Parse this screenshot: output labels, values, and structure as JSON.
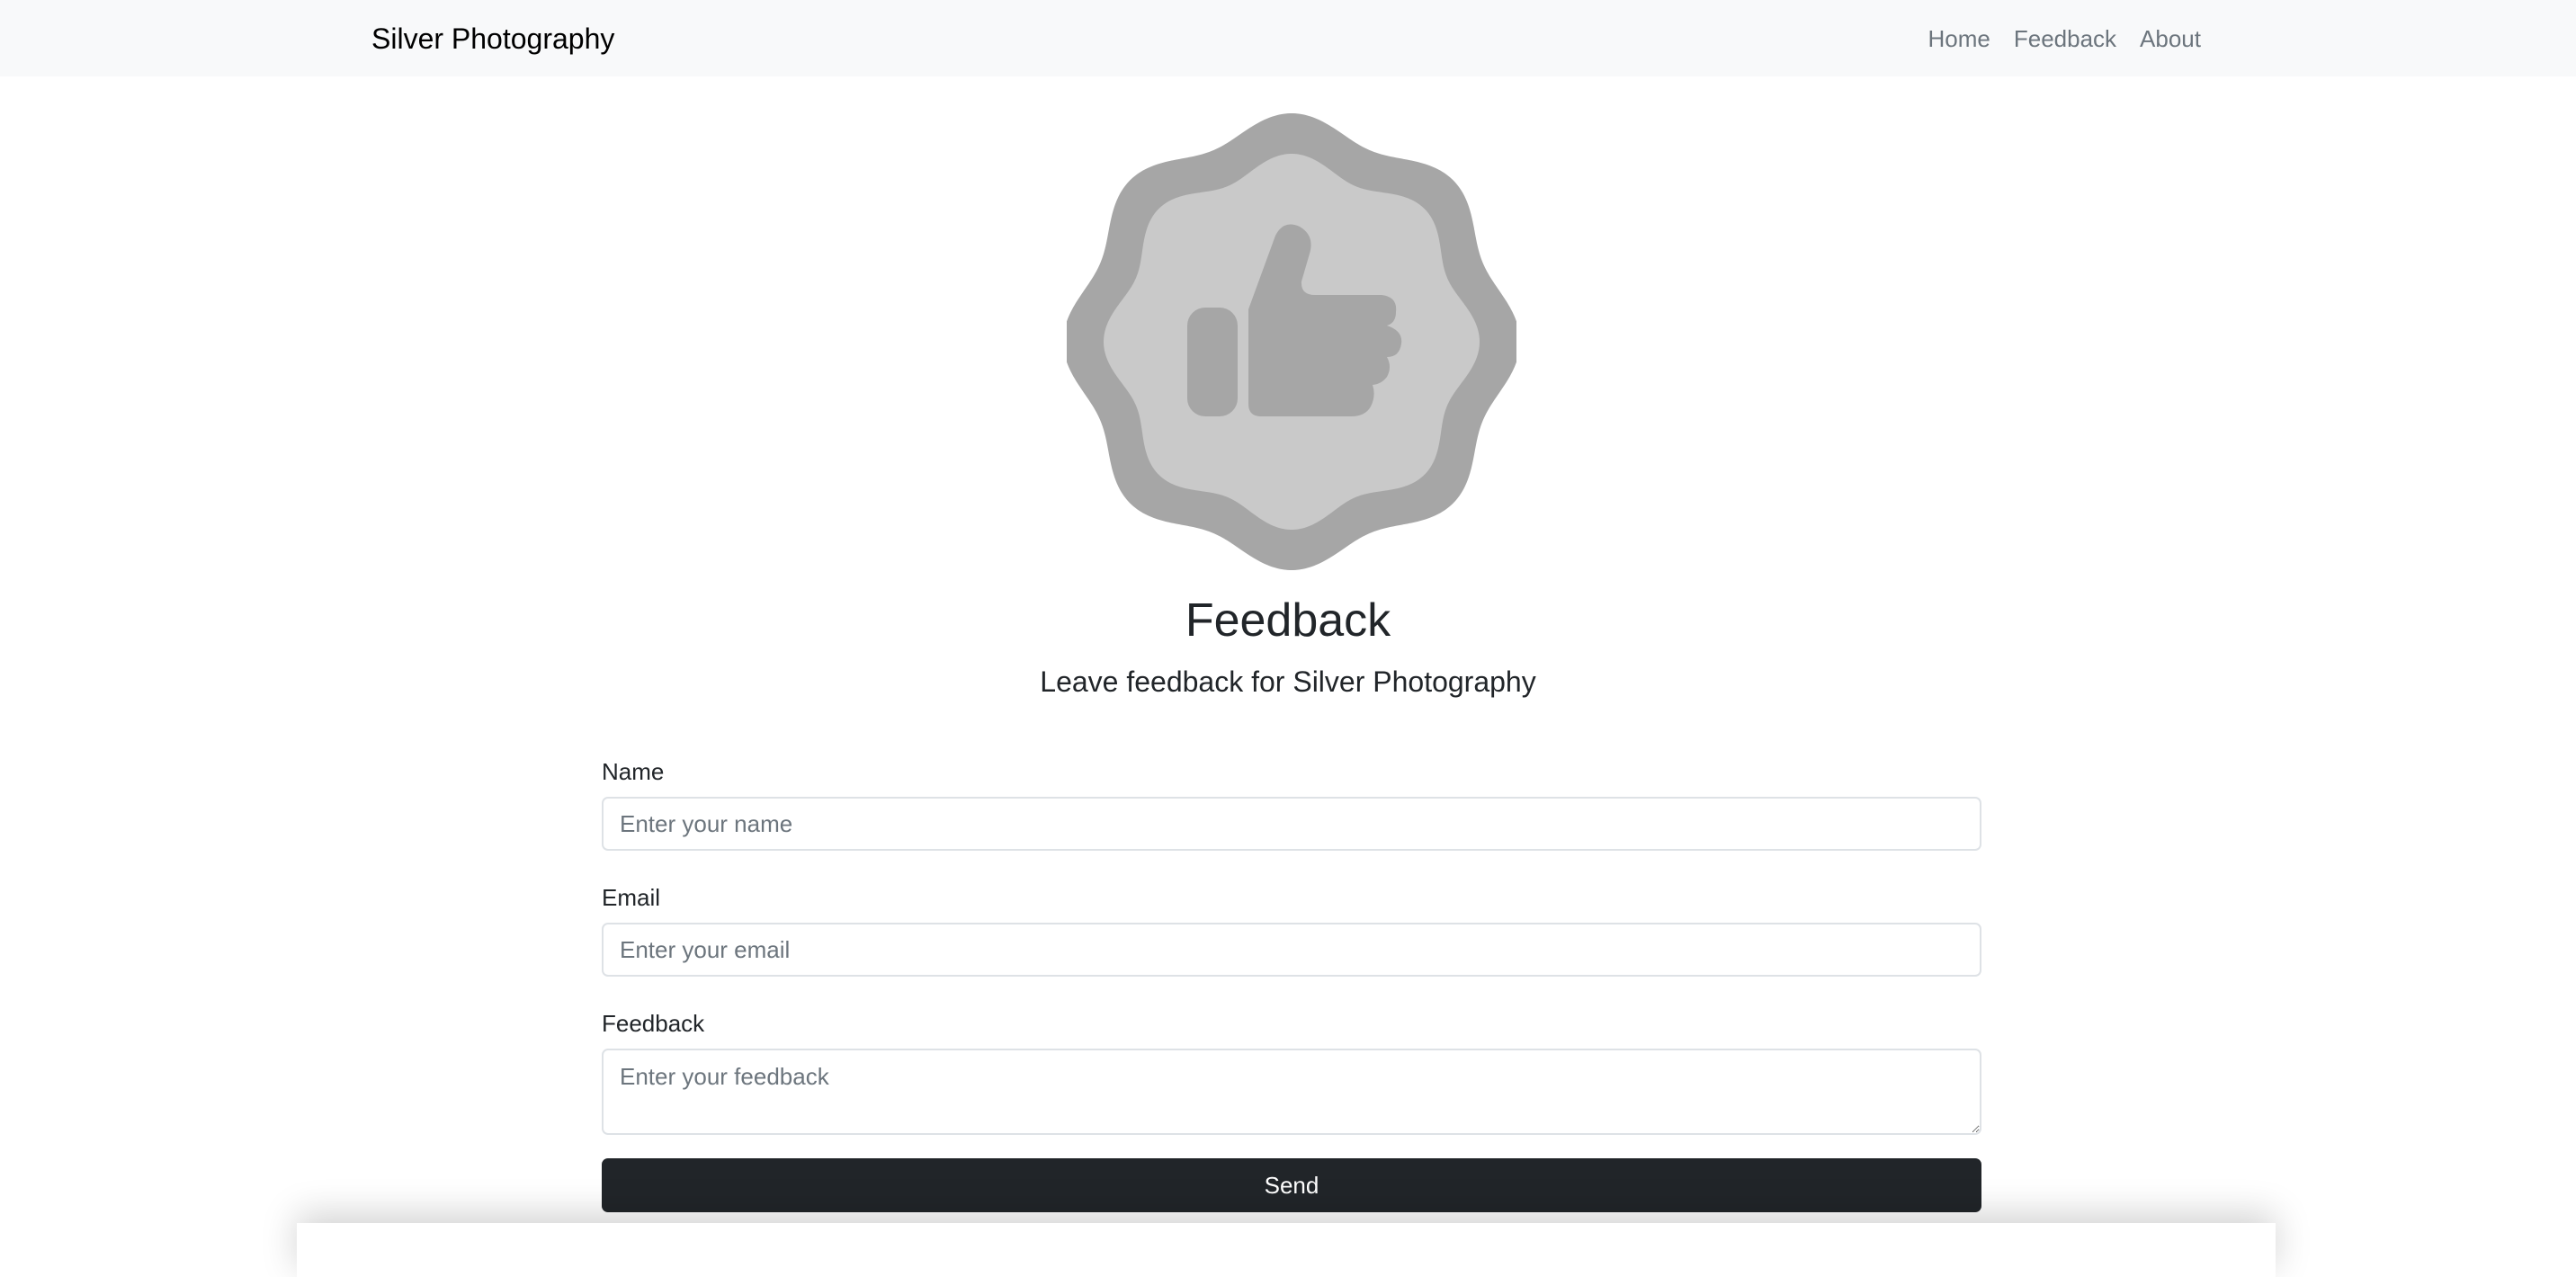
{
  "navbar": {
    "brand": "Silver Photography",
    "links": [
      {
        "label": "Home"
      },
      {
        "label": "Feedback"
      },
      {
        "label": "About"
      }
    ]
  },
  "hero": {
    "icon": "thumbs-up-badge-icon",
    "title": "Feedback",
    "subtitle": "Leave feedback for Silver Photography"
  },
  "form": {
    "name_label": "Name",
    "name_placeholder": "Enter your name",
    "email_label": "Email",
    "email_placeholder": "Enter your email",
    "feedback_label": "Feedback",
    "feedback_placeholder": "Enter your feedback",
    "send_label": "Send"
  },
  "colors": {
    "navbar_bg": "#f8f9fa",
    "badge_outer": "#a6a6a6",
    "badge_inner": "#c9c9c9",
    "button_bg": "#212529"
  }
}
